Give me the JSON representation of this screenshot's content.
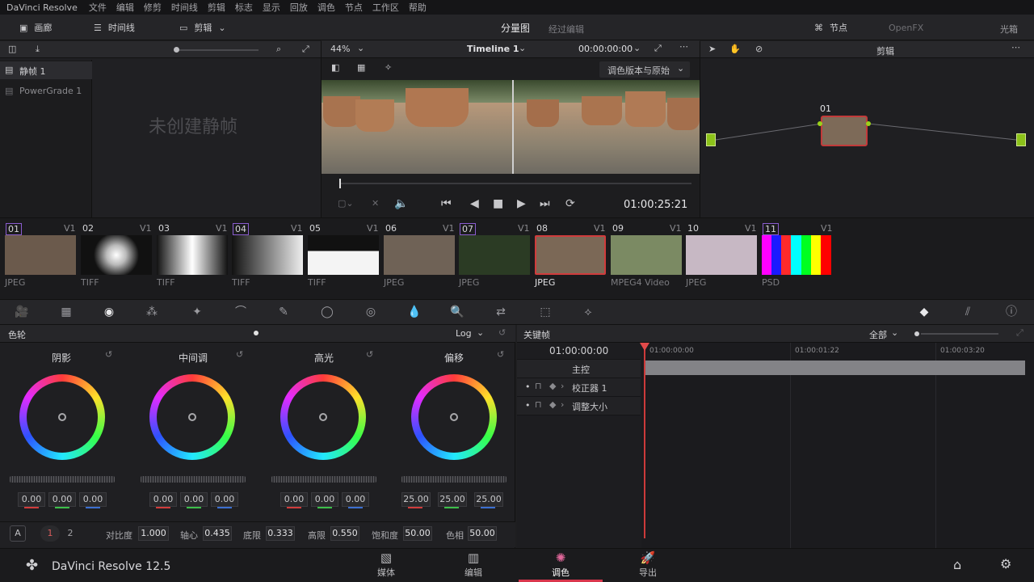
{
  "menubar": {
    "app_name": "DaVinci Resolve",
    "items": [
      "文件",
      "编辑",
      "修剪",
      "时间线",
      "剪辑",
      "标志",
      "显示",
      "回放",
      "调色",
      "节点",
      "工作区",
      "帮助"
    ]
  },
  "toolbar": {
    "gallery": "画廊",
    "timeline": "时间线",
    "clips": "剪辑",
    "split_screen": "分量图",
    "grade_mode": "经过编辑",
    "nodes": "节点",
    "openfx": "OpenFX",
    "lightbox": "光箱"
  },
  "gallery": {
    "albums": [
      "静帧 1",
      "PowerGrade 1"
    ],
    "empty_text": "未创建静帧"
  },
  "viewer": {
    "zoom": "44%",
    "timeline_name": "Timeline 1",
    "source_tc": "00:00:00:00",
    "compare_mode": "调色版本与原始",
    "timecode": "01:00:25:21"
  },
  "node_editor": {
    "mode": "剪辑",
    "node_label": "01",
    "accent": "#9ad11a"
  },
  "clips": [
    {
      "num": "01",
      "track": "V1",
      "type": "JPEG",
      "color": "#6b5a4c"
    },
    {
      "num": "02",
      "track": "V1",
      "type": "TIFF",
      "color": "#101010"
    },
    {
      "num": "03",
      "track": "V1",
      "type": "TIFF",
      "color": "#101010"
    },
    {
      "num": "04",
      "track": "V1",
      "type": "TIFF",
      "color": "#101010"
    },
    {
      "num": "05",
      "track": "V1",
      "type": "TIFF",
      "color": "#101010"
    },
    {
      "num": "06",
      "track": "V1",
      "type": "JPEG",
      "color": "#6f6256"
    },
    {
      "num": "07",
      "track": "V1",
      "type": "JPEG",
      "color": "#2b3b24"
    },
    {
      "num": "08",
      "track": "V1",
      "type": "JPEG",
      "color": "#7b6856"
    },
    {
      "num": "09",
      "track": "V1",
      "type": "MPEG4 Video",
      "color": "#7b8a63"
    },
    {
      "num": "10",
      "track": "V1",
      "type": "JPEG",
      "color": "#c7b8c4"
    },
    {
      "num": "11",
      "track": "V1",
      "type": "PSD",
      "color": "#fff"
    }
  ],
  "color_wheels": {
    "title": "色轮",
    "mode": "Log",
    "wheels": [
      {
        "label": "阴影",
        "values": [
          "0.00",
          "0.00",
          "0.00"
        ]
      },
      {
        "label": "中间调",
        "values": [
          "0.00",
          "0.00",
          "0.00"
        ]
      },
      {
        "label": "高光",
        "values": [
          "0.00",
          "0.00",
          "0.00"
        ]
      },
      {
        "label": "偏移",
        "values": [
          "25.00",
          "25.00",
          "25.00"
        ]
      }
    ],
    "params": [
      {
        "label": "对比度",
        "value": "1.000"
      },
      {
        "label": "轴心",
        "value": "0.435"
      },
      {
        "label": "底限",
        "value": "0.333"
      },
      {
        "label": "高限",
        "value": "0.550"
      },
      {
        "label": "饱和度",
        "value": "50.00"
      },
      {
        "label": "色相",
        "value": "50.00"
      }
    ],
    "page_a": "A",
    "page_1": "1",
    "page_2": "2"
  },
  "keyframes": {
    "title": "关键帧",
    "filter": "全部",
    "current_tc": "01:00:00:00",
    "ruler": [
      "01:00:00:00",
      "01:00:01:22",
      "01:00:03:20"
    ],
    "tracks": [
      "主控",
      "校正器 1",
      "调整大小"
    ]
  },
  "footer": {
    "product": "DaVinci Resolve 12.5",
    "tabs": [
      "媒体",
      "编辑",
      "调色",
      "导出"
    ]
  }
}
